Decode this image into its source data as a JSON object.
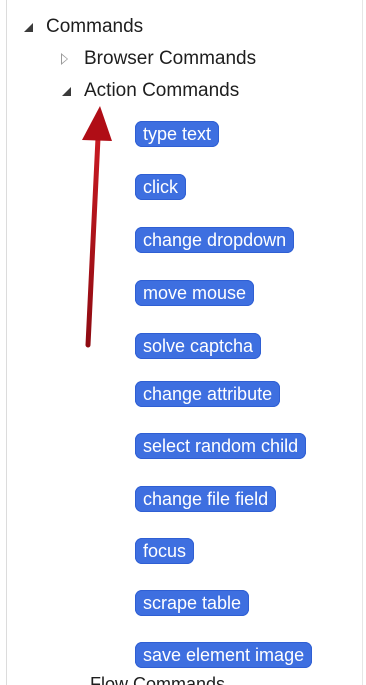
{
  "tree": {
    "root_label": "Commands",
    "browser_label": "Browser Commands",
    "action_label": "Action Commands",
    "partial_label": "Flow Commands"
  },
  "commands": [
    "type text",
    "click",
    "change dropdown",
    "move mouse",
    "solve captcha",
    "change attribute",
    "select random child",
    "change file field",
    "focus",
    "scrape table",
    "save element image"
  ],
  "colors": {
    "command_bg": "#3e6fe0",
    "arrow": "#b00d16"
  }
}
